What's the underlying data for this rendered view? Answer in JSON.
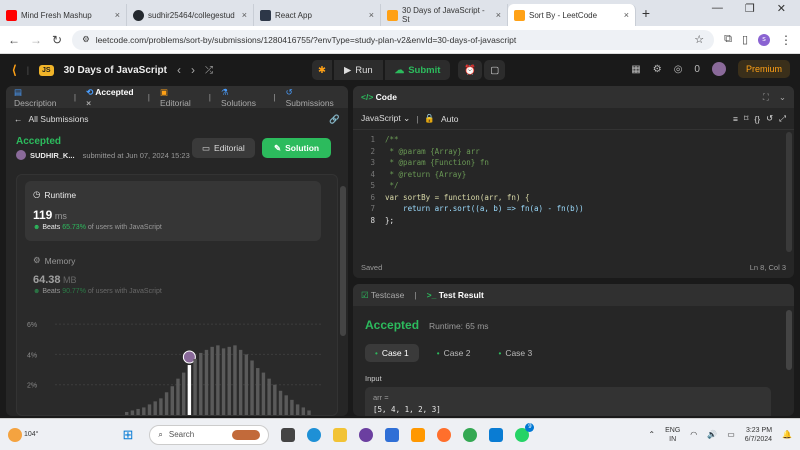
{
  "browser": {
    "tabs": [
      {
        "title": "Mind Fresh Mashup",
        "color": "#ff0000"
      },
      {
        "title": "sudhir25464/collegestud",
        "color": "#24292f"
      },
      {
        "title": "React App",
        "color": "#2d3748"
      },
      {
        "title": "30 Days of JavaScript - St",
        "color": "#ffa116"
      },
      {
        "title": "Sort By - LeetCode",
        "color": "#ffa116"
      }
    ],
    "url": "leetcode.com/problems/sort-by/submissions/1280416755/?envType=study-plan-v2&envId=30-days-of-javascript",
    "profile_initial": "s"
  },
  "leetcode": {
    "study_plan": "30 Days of JavaScript",
    "js_badge": "JS",
    "run_label": "Run",
    "submit_label": "Submit",
    "coins": "0",
    "premium_label": "Premium"
  },
  "left_panel": {
    "tabs": [
      "Description",
      "Accepted",
      "Editorial",
      "Solutions",
      "Submissions"
    ],
    "all_submissions": "All Submissions",
    "status": "Accepted",
    "user": "SUDHIR_K...",
    "submitted_at": "submitted at Jun 07, 2024 15:23",
    "editorial_btn": "Editorial",
    "solution_btn": "Solution",
    "runtime": {
      "title": "Runtime",
      "value": "119",
      "unit": "ms",
      "beats_label": "Beats",
      "beats": "65.73%",
      "suffix": "of users with JavaScript"
    },
    "memory": {
      "title": "Memory",
      "value": "64.38",
      "unit": "MB",
      "beats_label": "Beats",
      "beats": "90.77%",
      "suffix": "of users with JavaScript"
    },
    "chart_ticks": [
      "6%",
      "4%",
      "2%"
    ]
  },
  "chart_data": {
    "type": "bar",
    "ylim": [
      0,
      7
    ],
    "yticks": [
      2,
      4,
      6
    ],
    "values": [
      0.2,
      0.3,
      0.4,
      0.5,
      0.7,
      0.9,
      1.1,
      1.5,
      1.9,
      2.4,
      2.8,
      3.3,
      3.7,
      4.1,
      4.3,
      4.5,
      4.6,
      4.4,
      4.5,
      4.6,
      4.3,
      4.0,
      3.6,
      3.1,
      2.8,
      2.4,
      2.0,
      1.6,
      1.3,
      1.0,
      0.7,
      0.5,
      0.3
    ],
    "highlight_index": 11
  },
  "code_panel": {
    "title": "Code",
    "language": "JavaScript",
    "mode": "Auto",
    "lines": [
      "/**",
      " * @param {Array} arr",
      " * @param {Function} fn",
      " * @return {Array}",
      " */",
      "var sortBy = function(arr, fn) {",
      "    return arr.sort((a, b) => fn(a) - fn(b))",
      "};"
    ],
    "saved": "Saved",
    "cursor": "Ln 8, Col 3"
  },
  "result_panel": {
    "testcase_tab": "Testcase",
    "result_tab": "Test Result",
    "status": "Accepted",
    "runtime": "Runtime: 65 ms",
    "cases": [
      "Case 1",
      "Case 2",
      "Case 3"
    ],
    "input_label": "Input",
    "arr_label": "arr =",
    "arr_value": "[5, 4, 1, 2, 3]"
  },
  "taskbar": {
    "weather": "104°",
    "search": "Search",
    "lang": "ENG",
    "region": "IN",
    "time": "3:23 PM",
    "date": "6/7/2024",
    "badge": "9"
  }
}
